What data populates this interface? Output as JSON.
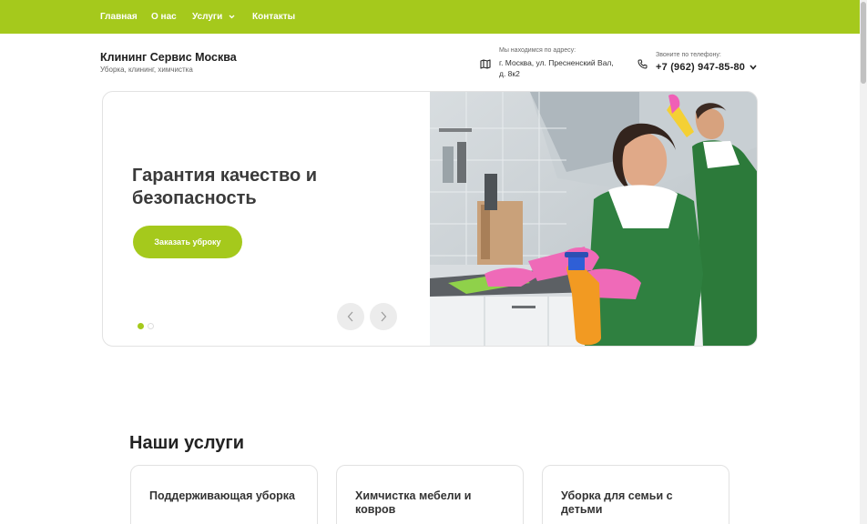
{
  "nav": {
    "items": [
      {
        "label": "Главная"
      },
      {
        "label": "О нас"
      },
      {
        "label": "Услуги"
      },
      {
        "label": "Контакты"
      }
    ]
  },
  "brand": {
    "title": "Клининг Сервис Москва",
    "subtitle": "Уборка, клининг, химчистка"
  },
  "address": {
    "label": "Мы  находимся по адресу:",
    "value": "г. Москва, ул. Пресненский Вал, д. 8к2"
  },
  "phone": {
    "label": "Звоните по телефону:",
    "value": "+7 (962) 947-85-80"
  },
  "hero": {
    "title": "Гарантия качество и безопасность",
    "button_label": "Заказать уброку",
    "active_slide": 1,
    "slide_count": 2
  },
  "services": {
    "title": "Наши услуги",
    "cards": [
      {
        "title": "Поддерживающая уборка"
      },
      {
        "title": "Химчистка мебели и ковров"
      },
      {
        "title": "Уборка для семьи с детьми"
      }
    ]
  },
  "colors": {
    "accent": "#a5c91c",
    "text": "#222222",
    "border": "#e2e2e2"
  },
  "icons": {
    "address": "map-icon",
    "phone": "phone-icon",
    "nav_dropdown": "chevron-down-icon",
    "prev": "chevron-left-icon",
    "next": "chevron-right-icon"
  }
}
